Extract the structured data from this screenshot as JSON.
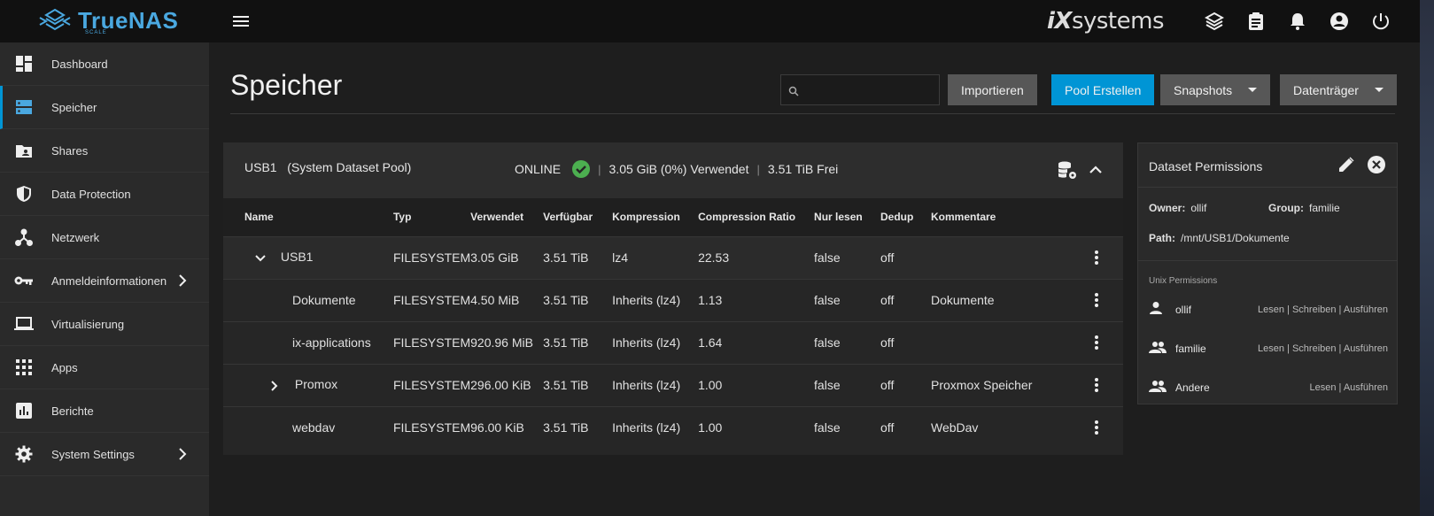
{
  "brand": {
    "name": "TrueNAS",
    "edition": "SCALE",
    "vendor_prefix": "iX",
    "vendor_suffix": "systems"
  },
  "colors": {
    "accent": "#0095d5",
    "ok": "#4caf50",
    "background": "#1e1e1e"
  },
  "topbar_icons": [
    "truecommand-icon",
    "clipboard-icon",
    "bell-icon",
    "account-icon",
    "power-icon"
  ],
  "sidebar": {
    "items": [
      {
        "label": "Dashboard",
        "icon": "dashboard-icon"
      },
      {
        "label": "Speicher",
        "icon": "storage-icon",
        "active": true
      },
      {
        "label": "Shares",
        "icon": "shares-icon"
      },
      {
        "label": "Data Protection",
        "icon": "shield-icon"
      },
      {
        "label": "Netzwerk",
        "icon": "network-icon"
      },
      {
        "label": "Anmeldeinformationen",
        "icon": "key-icon",
        "has_children": true
      },
      {
        "label": "Virtualisierung",
        "icon": "laptop-icon"
      },
      {
        "label": "Apps",
        "icon": "apps-grid-icon"
      },
      {
        "label": "Berichte",
        "icon": "chart-icon"
      },
      {
        "label": "System Settings",
        "icon": "gear-icon",
        "has_children": true
      }
    ]
  },
  "page": {
    "title": "Speicher"
  },
  "toolbar": {
    "search_placeholder": "",
    "import_label": "Importieren",
    "create_pool_label": "Pool Erstellen",
    "snapshots_label": "Snapshots",
    "disks_label": "Datenträger"
  },
  "pool": {
    "name": "USB1",
    "role": "(System Dataset Pool)",
    "status": "ONLINE",
    "used": "3.05 GiB (0%) Verwendet",
    "free": "3.51 TiB Frei"
  },
  "table": {
    "columns": [
      "Name",
      "Typ",
      "Verwendet",
      "Verfügbar",
      "Kompression",
      "Compression Ratio",
      "Nur lesen",
      "Dedup",
      "Kommentare"
    ],
    "rows": [
      {
        "name": "USB1",
        "type": "FILESYSTEM",
        "used": "3.05 GiB",
        "avail": "3.51 TiB",
        "compression": "lz4",
        "ratio": "22.53",
        "readonly": "false",
        "dedup": "off",
        "comment": "",
        "toggle": "expanded",
        "level": 0
      },
      {
        "name": "Dokumente",
        "type": "FILESYSTEM",
        "used": "4.50 MiB",
        "avail": "3.51 TiB",
        "compression": "Inherits (lz4)",
        "ratio": "1.13",
        "readonly": "false",
        "dedup": "off",
        "comment": "Dokumente",
        "toggle": "none",
        "level": 1
      },
      {
        "name": "ix-applications",
        "type": "FILESYSTEM",
        "used": "920.96 MiB",
        "avail": "3.51 TiB",
        "compression": "Inherits (lz4)",
        "ratio": "1.64",
        "readonly": "false",
        "dedup": "off",
        "comment": "",
        "toggle": "none",
        "level": 1
      },
      {
        "name": "Promox",
        "type": "FILESYSTEM",
        "used": "296.00 KiB",
        "avail": "3.51 TiB",
        "compression": "Inherits (lz4)",
        "ratio": "1.00",
        "readonly": "false",
        "dedup": "off",
        "comment": "Proxmox Speicher",
        "toggle": "collapsed",
        "level": 1
      },
      {
        "name": "webdav",
        "type": "FILESYSTEM",
        "used": "96.00 KiB",
        "avail": "3.51 TiB",
        "compression": "Inherits (lz4)",
        "ratio": "1.00",
        "readonly": "false",
        "dedup": "off",
        "comment": "WebDav",
        "toggle": "none",
        "level": 1
      }
    ]
  },
  "permissions": {
    "title": "Dataset Permissions",
    "owner_label": "Owner:",
    "owner": "ollif",
    "group_label": "Group:",
    "group": "familie",
    "path_label": "Path:",
    "path": "/mnt/USB1/Dokumente",
    "unix_label": "Unix Permissions",
    "entries": [
      {
        "who": "ollif",
        "rights": "Lesen | Schreiben | Ausführen",
        "icon": "person-icon"
      },
      {
        "who": "familie",
        "rights": "Lesen | Schreiben | Ausführen",
        "icon": "group-icon"
      },
      {
        "who": "Andere",
        "rights": "Lesen | Ausführen",
        "icon": "group-icon"
      }
    ]
  }
}
